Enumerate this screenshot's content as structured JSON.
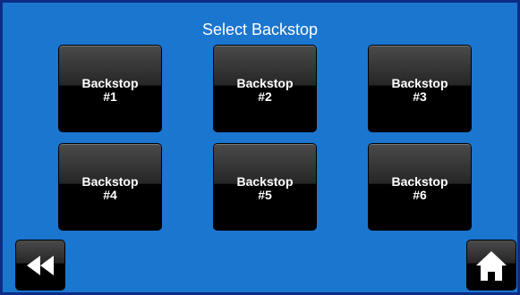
{
  "screen": {
    "title": "Select Backstop"
  },
  "backstops": [
    {
      "line1": "Backstop",
      "line2": "#1"
    },
    {
      "line1": "Backstop",
      "line2": "#2"
    },
    {
      "line1": "Backstop",
      "line2": "#3"
    },
    {
      "line1": "Backstop",
      "line2": "#4"
    },
    {
      "line1": "Backstop",
      "line2": "#5"
    },
    {
      "line1": "Backstop",
      "line2": "#6"
    }
  ],
  "navigation": {
    "back_icon": "double-left-arrow-icon",
    "home_icon": "home-icon"
  },
  "colors": {
    "background": "#1b76d0",
    "border": "#0d2c86",
    "button": "#000000",
    "text": "#ffffff"
  }
}
